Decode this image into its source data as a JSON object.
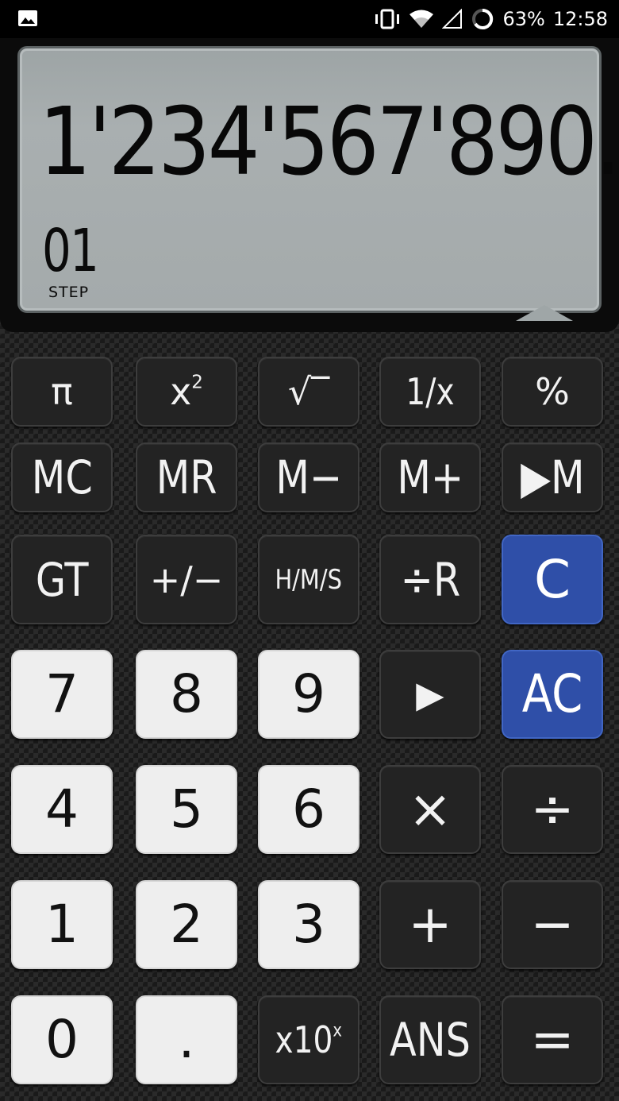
{
  "status_bar": {
    "battery_percent": "63%",
    "time": "12:58",
    "icons": [
      "gallery-icon",
      "vibrate-icon",
      "wifi-icon",
      "cell-signal-icon",
      "battery-icon"
    ]
  },
  "display": {
    "main_value": "1'234'567'890.",
    "step_number": "01",
    "step_label": "STEP"
  },
  "colors": {
    "lcd_background": "#a4aaab",
    "function_key": "#232323",
    "number_key": "#eeeeee",
    "clear_key": "#2f4fa8"
  },
  "keys": {
    "pi": "π",
    "square": "x",
    "square_exp": "2",
    "sqrt": "√‾",
    "reciprocal": "1/x",
    "percent": "%",
    "mc": "MC",
    "mr": "MR",
    "m_minus": "M−",
    "m_plus": "M+",
    "store_m": "▶M",
    "gt": "GT",
    "plus_minus": "+/−",
    "hms": "H/M/S",
    "div_remainder": "÷R",
    "clear": "C",
    "seven": "7",
    "eight": "8",
    "nine": "9",
    "step_forward": "▶",
    "all_clear": "AC",
    "four": "4",
    "five": "5",
    "six": "6",
    "multiply": "×",
    "divide": "÷",
    "one": "1",
    "two": "2",
    "three": "3",
    "plus": "+",
    "minus": "−",
    "zero": "0",
    "decimal": ".",
    "exp10": "x10",
    "exp10_sup": "x",
    "ans": "ANS",
    "equals": "="
  }
}
